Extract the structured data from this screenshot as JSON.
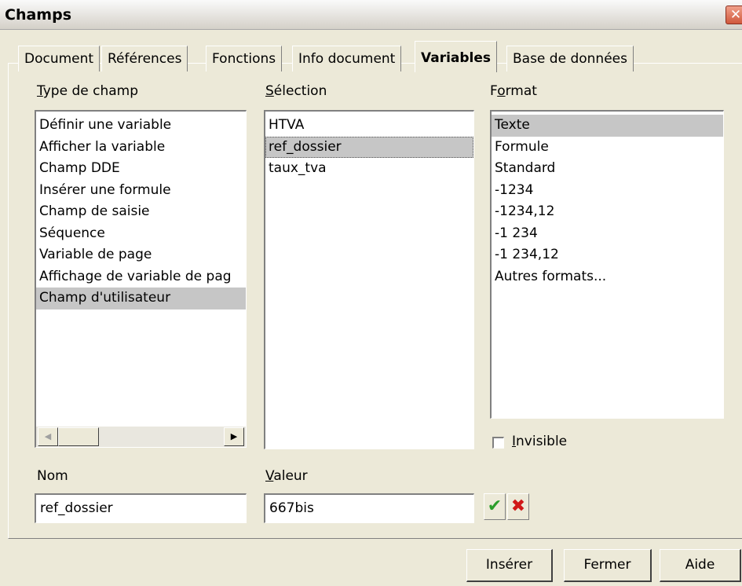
{
  "window": {
    "title": "Champs",
    "close_glyph": "✕"
  },
  "tabs": [
    {
      "label": "Document"
    },
    {
      "label": "Références"
    },
    {
      "label": "Fonctions"
    },
    {
      "label": "Info document"
    },
    {
      "label": "Variables",
      "active": true
    },
    {
      "label": "Base de données"
    }
  ],
  "type_de_champ": {
    "label_mnemonic": "T",
    "label_rest": "ype de champ",
    "items": [
      "Définir une variable",
      "Afficher la variable",
      "Champ DDE",
      "Insérer une formule",
      "Champ de saisie",
      "Séquence",
      "Variable de page",
      "Affichage de variable de pag",
      "Champ d'utilisateur"
    ],
    "selected": "Champ d'utilisateur"
  },
  "selection": {
    "label_mnemonic": "S",
    "label_rest": "élection",
    "items": [
      "HTVA",
      "ref_dossier",
      "taux_tva"
    ],
    "selected": "ref_dossier"
  },
  "format": {
    "label_pre": "F",
    "label_mnemonic": "o",
    "label_rest": "rmat",
    "items": [
      "Texte",
      "Formule",
      "Standard",
      "-1234",
      "-1234,12",
      "-1 234",
      "-1 234,12",
      "Autres formats..."
    ],
    "selected": "Texte"
  },
  "invisible": {
    "label_mnemonic": "I",
    "label_rest": "nvisible",
    "checked": false
  },
  "nom": {
    "label": "Nom",
    "value": "ref_dossier"
  },
  "valeur": {
    "label_mnemonic": "V",
    "label_rest": "aleur",
    "value": "667bis"
  },
  "value_buttons": {
    "apply_glyph": "✔",
    "delete_glyph": "✖",
    "apply_color": "#2a9d2a",
    "delete_color": "#d01818"
  },
  "buttons": {
    "insert": "Insérer",
    "close": "Fermer",
    "help": "Aide"
  },
  "colors": {
    "dialog_bg": "#ece9d8",
    "selection_bg": "#c6c6c6"
  }
}
